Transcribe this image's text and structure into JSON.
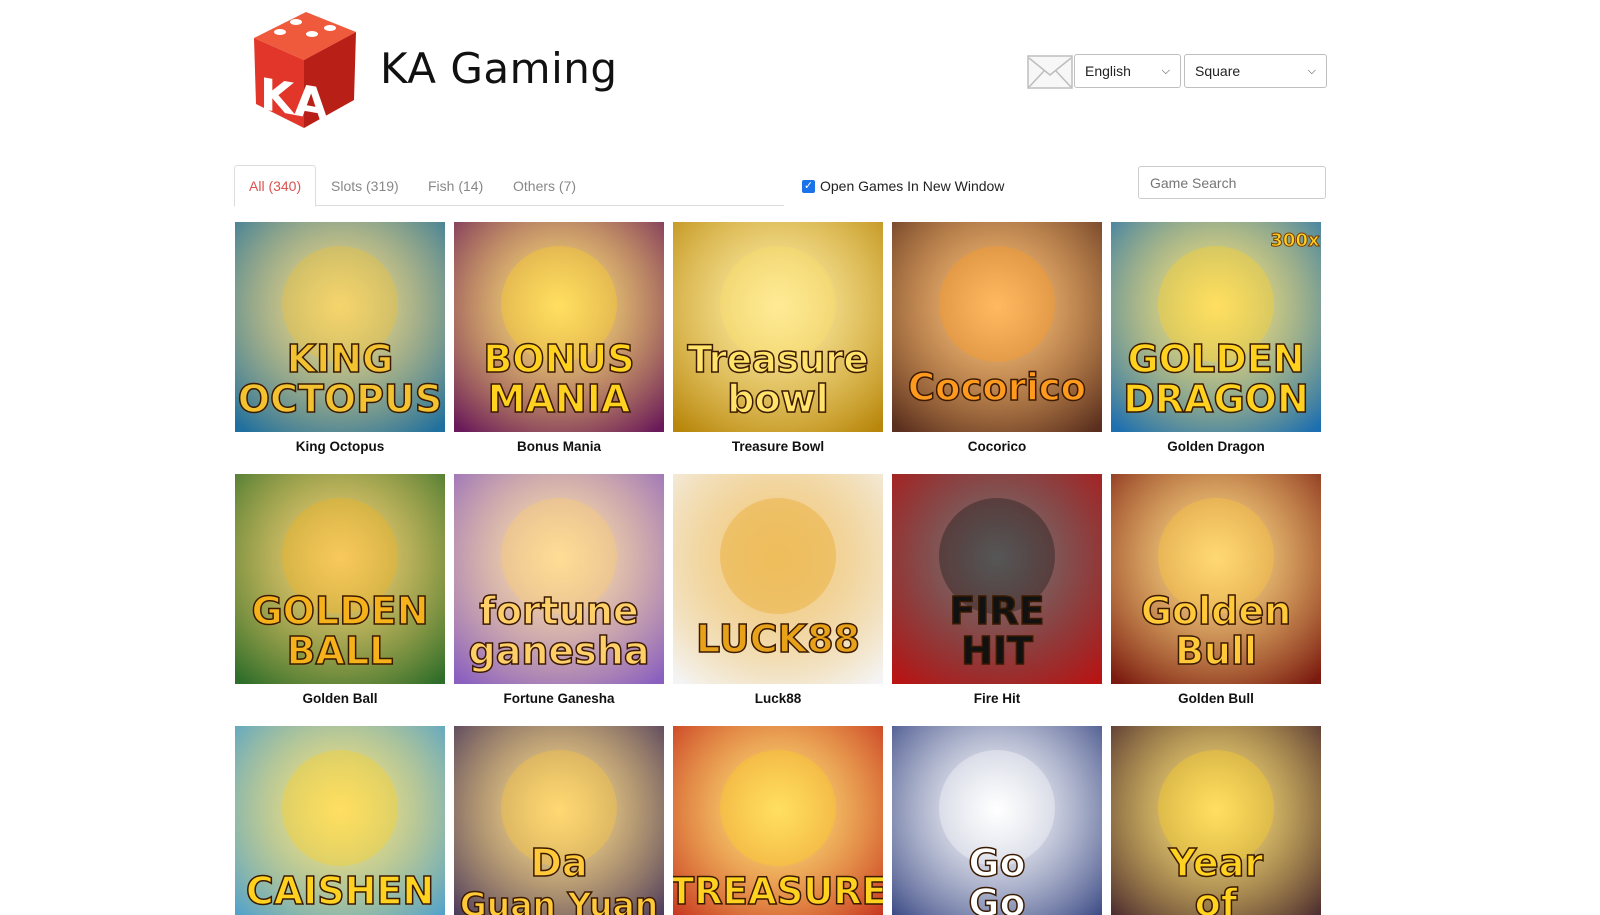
{
  "header": {
    "brand": "KA Gaming",
    "logo_letters": "KA",
    "language_select": "English",
    "view_select": "Square"
  },
  "filters": {
    "tabs": [
      {
        "label": "All (340)",
        "active": true
      },
      {
        "label": "Slots (319)",
        "active": false
      },
      {
        "label": "Fish (14)",
        "active": false
      },
      {
        "label": "Others (7)",
        "active": false
      }
    ],
    "open_new_window_label": "Open Games In New Window",
    "open_new_window_checked": true,
    "search_placeholder": "Game Search"
  },
  "games": [
    {
      "name": "King Octopus",
      "art": "KING OCTOPUS",
      "bg": "#1f6f9f",
      "fg": "#f2c230"
    },
    {
      "name": "Bonus Mania",
      "art": "BONUS MANIA",
      "bg": "#6a1a5a",
      "fg": "#ffd21f"
    },
    {
      "name": "Treasure Bowl",
      "art": "Treasure bowl",
      "bg": "#b8860b",
      "fg": "#ffe36a"
    },
    {
      "name": "Cocorico",
      "art": "Cocorico",
      "bg": "#5a2f1e",
      "fg": "#ff9a1f"
    },
    {
      "name": "Golden Dragon",
      "art": "GOLDEN DRAGON",
      "bg": "#1d6fb0",
      "fg": "#ffd21f",
      "badge": "300x"
    },
    {
      "name": "Golden Ball",
      "art": "GOLDEN BALL",
      "bg": "#2f6e2a",
      "fg": "#f5b21a"
    },
    {
      "name": "Fortune Ganesha",
      "art": "fortune ganesha",
      "bg": "#8a5fc0",
      "fg": "#ffcf6a"
    },
    {
      "name": "Luck88",
      "art": "LUCK88",
      "bg": "#f4f4f4",
      "fg": "#e8a21a"
    },
    {
      "name": "Fire Hit",
      "art": "FIRE HIT",
      "bg": "#b81414",
      "fg": "#111111"
    },
    {
      "name": "Golden Bull",
      "art": "Golden Bull",
      "bg": "#7a1a10",
      "fg": "#ffc93a"
    },
    {
      "name": "",
      "art": "CAISHEN",
      "bg": "#3f9bd6",
      "fg": "#ffd21f"
    },
    {
      "name": "",
      "art": "Da Guan Yuan",
      "bg": "#3a2a5a",
      "fg": "#ffc93a"
    },
    {
      "name": "",
      "art": "TREASURE",
      "bg": "#c2261a",
      "fg": "#ffd21f"
    },
    {
      "name": "",
      "art": "Go Go",
      "bg": "#2a3a7a",
      "fg": "#ffffff"
    },
    {
      "name": "",
      "art": "Year of",
      "bg": "#3a1a2a",
      "fg": "#ffd21f"
    }
  ],
  "colors": {
    "active_tab": "#d9534f",
    "logo_red": "#e2362a",
    "checkbox": "#1a73e8"
  }
}
